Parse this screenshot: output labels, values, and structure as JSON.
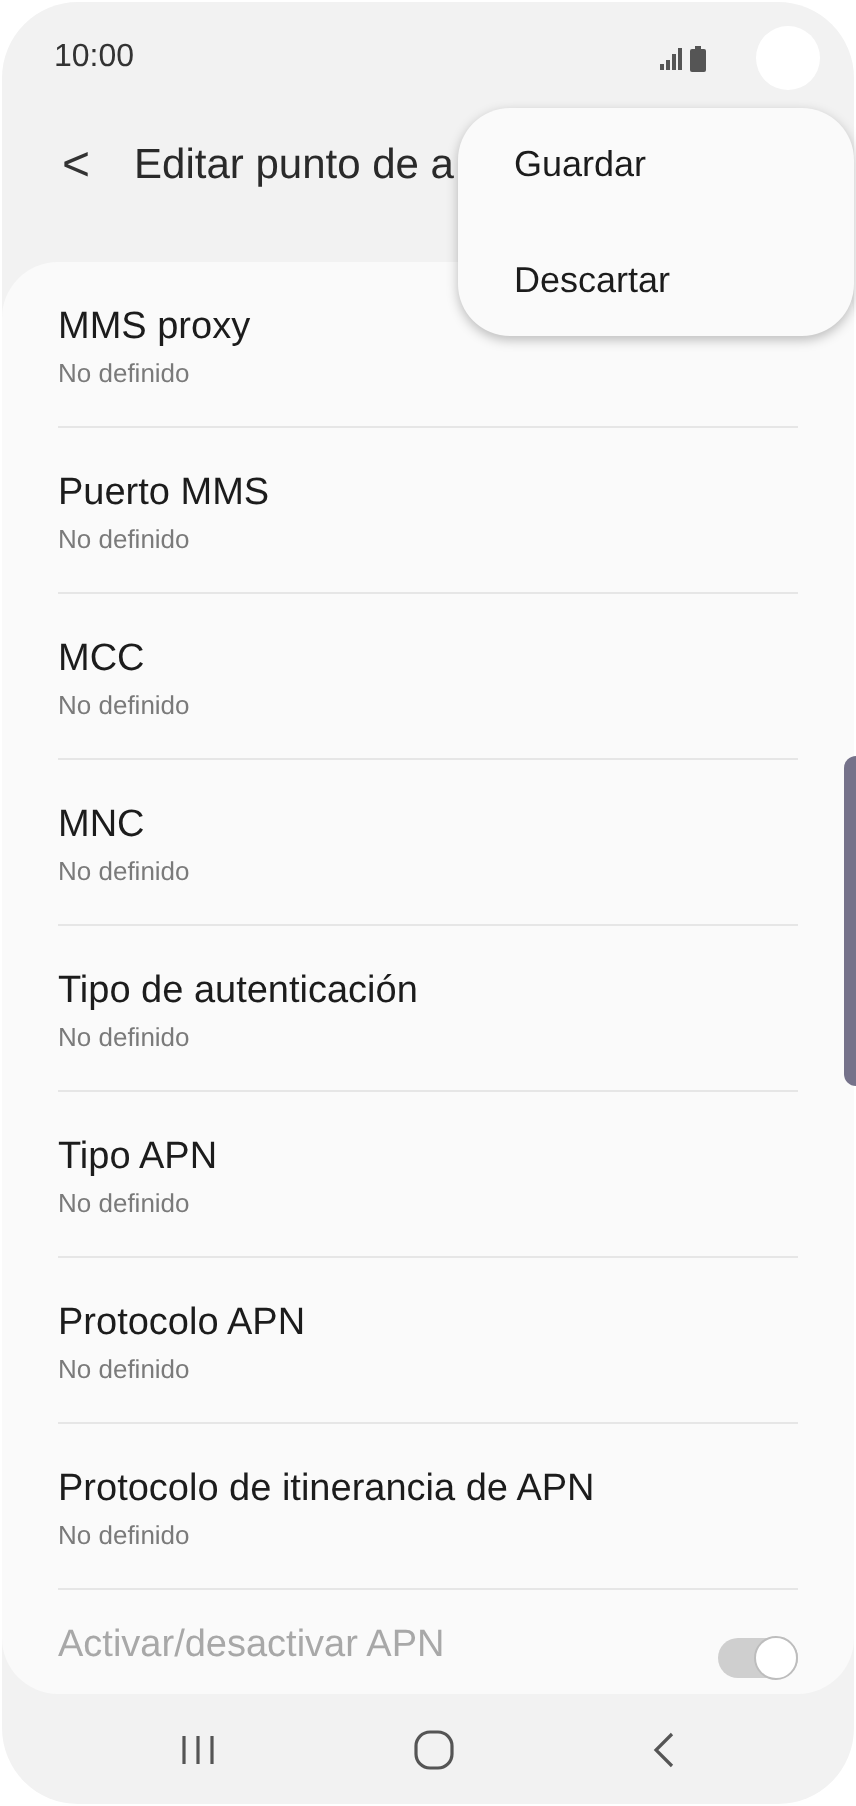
{
  "status_bar": {
    "time": "10:00"
  },
  "header": {
    "back": "<",
    "title": "Editar punto de a"
  },
  "menu": {
    "items": [
      "Guardar",
      "Descartar"
    ]
  },
  "settings": [
    {
      "kind": "text",
      "title": "MMS proxy",
      "value": "No definido"
    },
    {
      "kind": "text",
      "title": "Puerto MMS",
      "value": "No definido"
    },
    {
      "kind": "text",
      "title": "MCC",
      "value": "No definido"
    },
    {
      "kind": "text",
      "title": "MNC",
      "value": "No definido"
    },
    {
      "kind": "text",
      "title": "Tipo de autenticación",
      "value": "No definido"
    },
    {
      "kind": "text",
      "title": "Tipo APN",
      "value": "No definido"
    },
    {
      "kind": "text",
      "title": "Protocolo APN",
      "value": "No definido"
    },
    {
      "kind": "text",
      "title": "Protocolo de itinerancia de APN",
      "value": "No definido"
    },
    {
      "kind": "toggle",
      "title": "Activar/desactivar APN",
      "on": true,
      "disabled": true
    }
  ]
}
